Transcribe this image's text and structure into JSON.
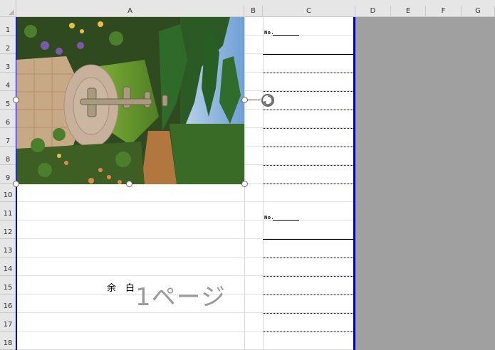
{
  "columns": [
    "A",
    "B",
    "C",
    "D",
    "E",
    "F",
    "G"
  ],
  "rows": [
    "1",
    "2",
    "3",
    "4",
    "5",
    "6",
    "7",
    "8",
    "9",
    "10",
    "11",
    "12",
    "13",
    "14",
    "15",
    "16",
    "17",
    "18"
  ],
  "blocks": [
    {
      "no_label": "No."
    },
    {
      "no_label": "No."
    }
  ],
  "watermark": {
    "yohaku": "余　白",
    "page_text": "1ページ"
  },
  "picture": {
    "subject": "garden-with-fountain-image"
  },
  "colors": {
    "page_border": "#0000c0",
    "out_of_print": "#a0a0a0",
    "header_bg": "#e6e6e6"
  }
}
